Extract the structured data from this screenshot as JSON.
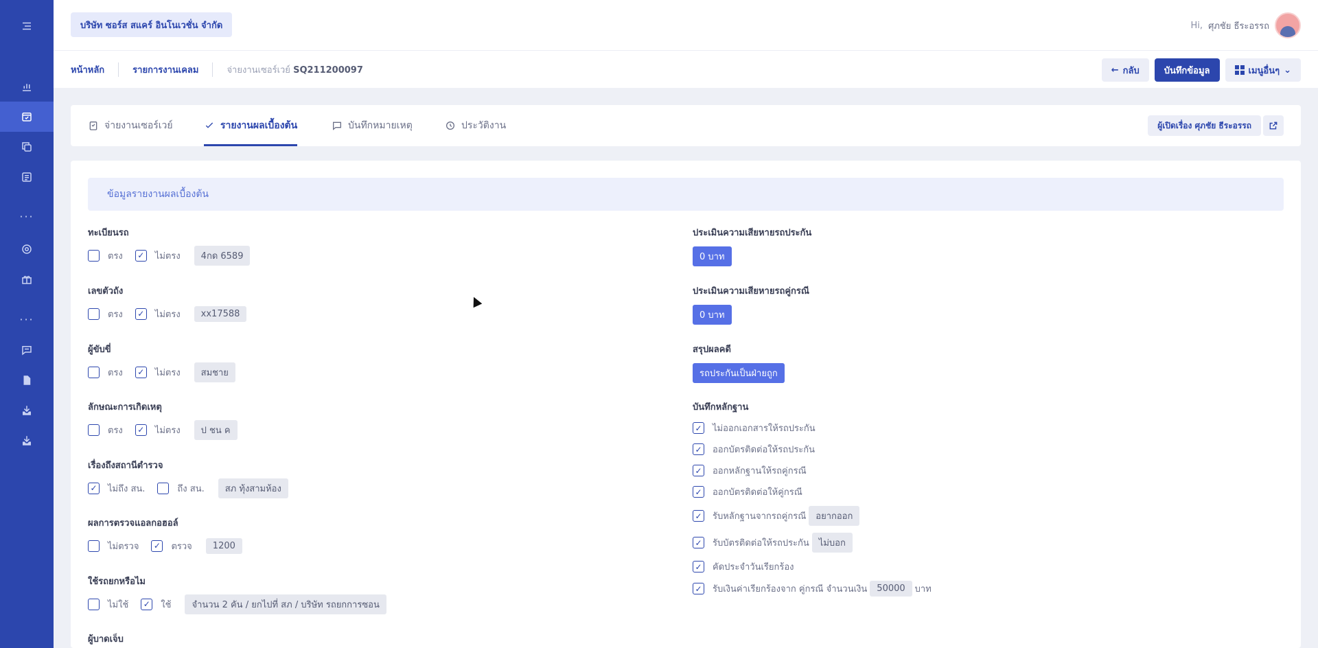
{
  "topbar": {
    "company": "บริษัท ซอร์ส สแคร์ อินโนเวชั่น จำกัด",
    "greeting": "Hi,",
    "user_name": "ศุภชัย ธีระอรรถ"
  },
  "breadcrumb": {
    "home": "หน้าหลัก",
    "claims": "รายการงานเคลม",
    "current_prefix": "จ่ายงานเซอร์เวย์",
    "current_id": "SQ211200097"
  },
  "actions": {
    "back": "กลับ",
    "save": "บันทึกข้อมูล",
    "more": "เมนูอื่นๆ"
  },
  "tabs": [
    {
      "label": "จ่ายงานเซอร์เวย์"
    },
    {
      "label": "รายงานผลเบื้องต้น"
    },
    {
      "label": "บันทึกหมายเหตุ"
    },
    {
      "label": "ประวัติงาน"
    }
  ],
  "opener": "ผู้เปิดเรื่อง ศุภชัย ธีระอรรถ",
  "section_title": "ข้อมูลรายงานผลเบื้องต้น",
  "left_fields": [
    {
      "label": "ทะเบียนรถ",
      "opt1": "ตรง",
      "opt2": "ไม่ตรง",
      "value": "4กด 6589"
    },
    {
      "label": "เลขตัวถัง",
      "opt1": "ตรง",
      "opt2": "ไม่ตรง",
      "value": "xx17588"
    },
    {
      "label": "ผู้ขับขี่",
      "opt1": "ตรง",
      "opt2": "ไม่ตรง",
      "value": "สมชาย"
    },
    {
      "label": "ลักษณะการเกิดเหตุ",
      "opt1": "ตรง",
      "opt2": "ไม่ตรง",
      "value": "ป ชน ค"
    },
    {
      "label": "เรื่องถึงสถานีตำรวจ",
      "opt1": "ไม่ถึง สน.",
      "opt2": "ถึง สน.",
      "value": "สภ ทุ้งสามห้อง"
    },
    {
      "label": "ผลการตรวจแอลกอฮอล์",
      "opt1": "ไม่ตรวจ",
      "opt2": "ตรวจ",
      "value": "1200"
    },
    {
      "label": "ใช้รถยกหรือไม",
      "opt1": "ไม่ใช้",
      "opt2": "ใช้",
      "value": "จำนวน 2 คัน / ยกไปที่ สภ / บริษัท รถยกการซอน"
    },
    {
      "label": "ผู้บาดเจ็บ"
    }
  ],
  "right": {
    "damage_insured_label": "ประเมินความเสียหายรถประกัน",
    "damage_insured_value": "0 บาท",
    "damage_party_label": "ประเมินความเสียหายรถคู่กรณี",
    "damage_party_value": "0 บาท",
    "result_label": "สรุปผลคดี",
    "result_value": "รถประกันเป็นฝ่ายถูก",
    "evidence_label": "บันทึกหลักฐาน",
    "evidence": [
      {
        "text": "ไม่ออกเอกสารให้รถประกัน"
      },
      {
        "text": "ออกบัตรติดต่อให้รถประกัน"
      },
      {
        "text": "ออกหลักฐานให้รถคู่กรณี"
      },
      {
        "text": "ออกบัตรติดต่อให้คู่กรณี"
      },
      {
        "text": "รับหลักฐานจากรถคู่กรณี",
        "tag": "อยากออก"
      },
      {
        "text": "รับบัตรติดต่อให้รถประกัน",
        "tag": "ไม่บอก"
      },
      {
        "text": "คัดประจำวันเรียกร้อง"
      },
      {
        "text": "รับเงินค่าเรียกร้องจาก คู่กรณี จำนวนเงิน",
        "tag": "50000",
        "suffix": "บาท"
      }
    ]
  },
  "colors": {
    "sidebar": "#2c46ad",
    "primary": "#2c46ad",
    "badge": "#5670e6"
  }
}
